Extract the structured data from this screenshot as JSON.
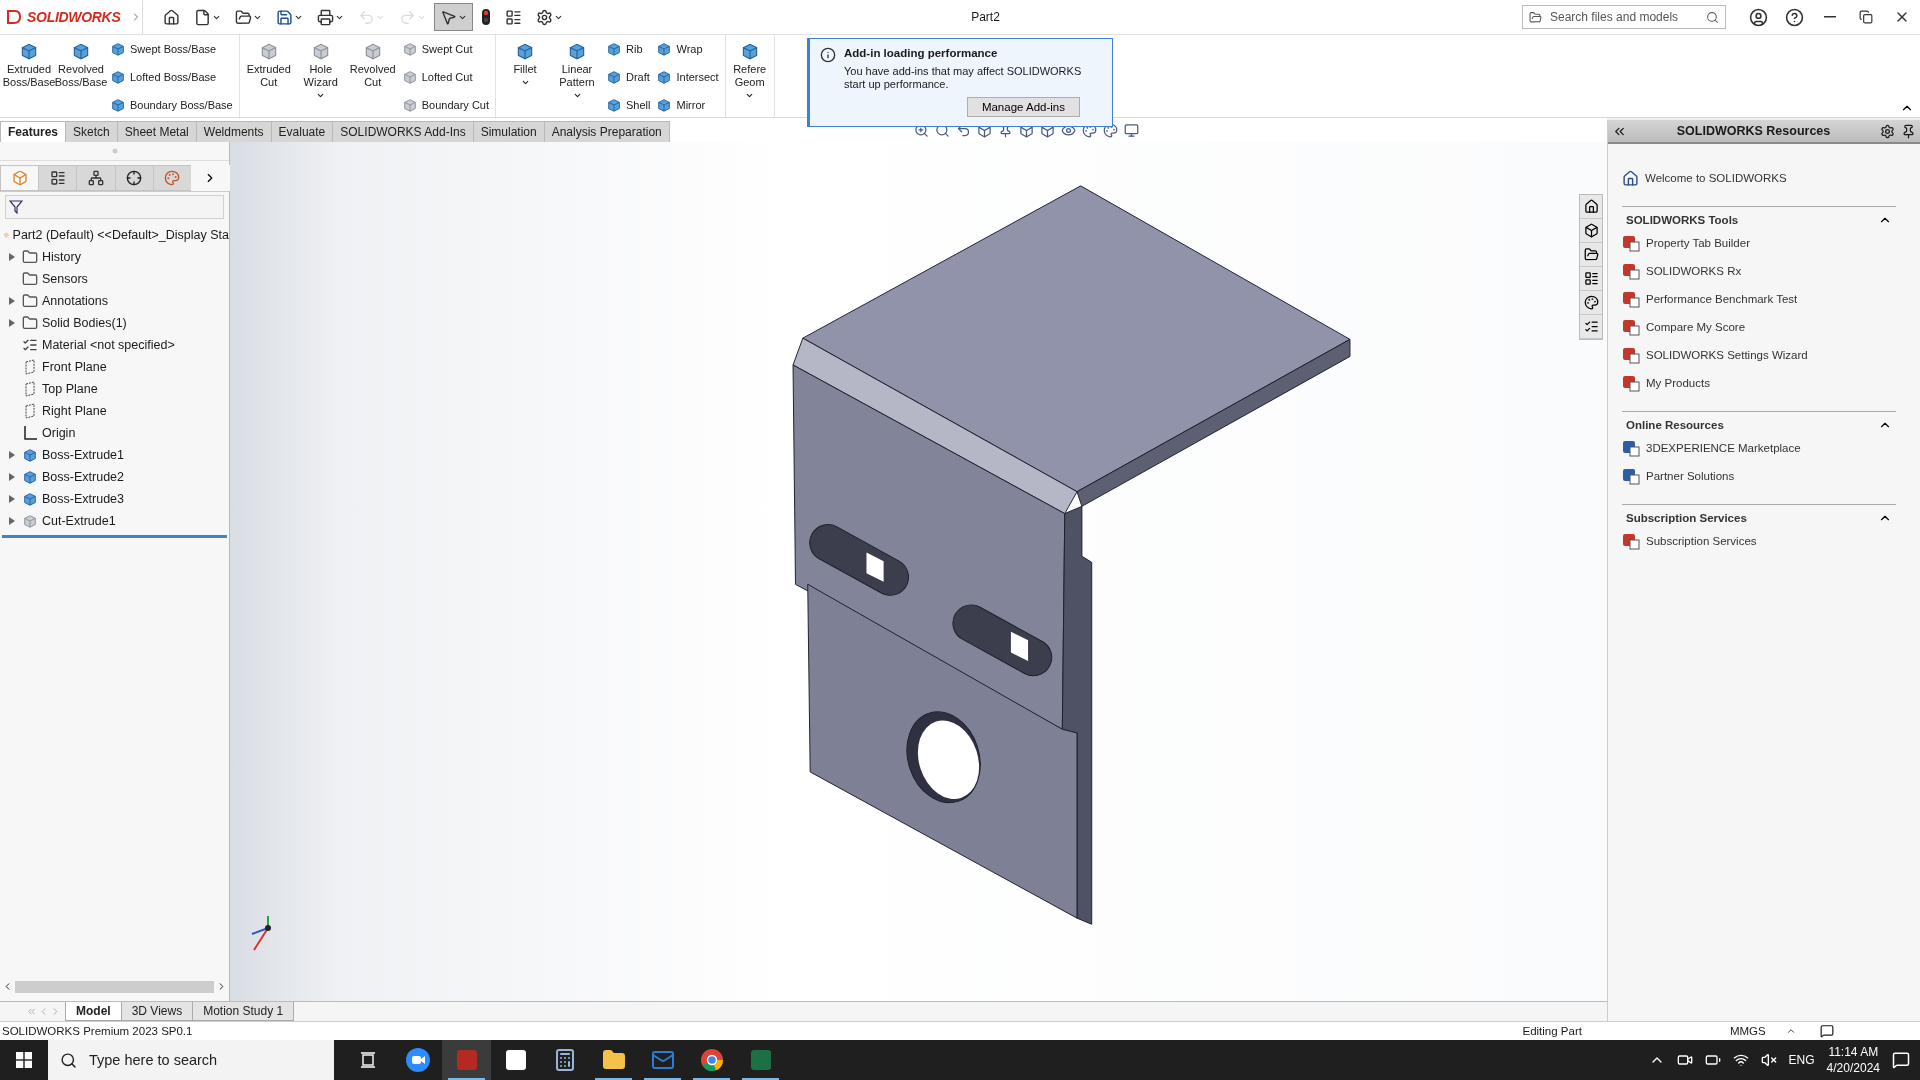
{
  "title_bar": {
    "app_name": "SOLIDWORKS",
    "document_title": "Part2",
    "search_placeholder": "Search files and models"
  },
  "quick_access": [
    {
      "kind": "home",
      "disabled": false,
      "selected": false
    },
    {
      "kind": "new",
      "disabled": false,
      "selected": false
    },
    {
      "kind": "open",
      "disabled": false,
      "selected": false
    },
    {
      "kind": "save",
      "disabled": false,
      "selected": false
    },
    {
      "kind": "print",
      "disabled": false,
      "selected": false
    },
    {
      "kind": "undo",
      "disabled": true,
      "selected": false
    },
    {
      "kind": "redo",
      "disabled": true,
      "selected": false
    },
    {
      "kind": "select",
      "disabled": false,
      "selected": true
    },
    {
      "kind": "rebuild",
      "disabled": false,
      "selected": false
    },
    {
      "kind": "file-properties",
      "disabled": false,
      "selected": false
    },
    {
      "kind": "options",
      "disabled": false,
      "selected": false
    }
  ],
  "ribbon": [
    {
      "items": [
        {
          "kind": "large",
          "label": "Extruded Boss/Base",
          "dropdown": false
        },
        {
          "kind": "large",
          "label": "Revolved Boss/Base",
          "dropdown": false
        },
        {
          "kind": "stack",
          "commands": [
            "Swept Boss/Base",
            "Lofted Boss/Base",
            "Boundary Boss/Base"
          ]
        }
      ]
    },
    {
      "items": [
        {
          "kind": "large",
          "label": "Extruded Cut",
          "dropdown": false
        },
        {
          "kind": "large",
          "label": "Hole Wizard",
          "dropdown": true
        },
        {
          "kind": "large",
          "label": "Revolved Cut",
          "dropdown": false
        },
        {
          "kind": "stack",
          "commands": [
            "Swept Cut",
            "Lofted Cut",
            "Boundary Cut"
          ]
        }
      ]
    },
    {
      "items": [
        {
          "kind": "large",
          "label": "Fillet",
          "dropdown": true
        },
        {
          "kind": "large",
          "label": "Linear Pattern",
          "dropdown": true
        },
        {
          "kind": "stack",
          "commands": [
            "Rib",
            "Draft",
            "Shell"
          ]
        },
        {
          "kind": "stack",
          "commands": [
            "Wrap",
            "Intersect",
            "Mirror"
          ]
        }
      ]
    },
    {
      "items": [
        {
          "kind": "large",
          "label": "Refere Geom",
          "dropdown": true
        }
      ]
    }
  ],
  "command_tabs": [
    {
      "label": "Features",
      "selected": true
    },
    {
      "label": "Sketch",
      "selected": false
    },
    {
      "label": "Sheet Metal",
      "selected": false
    },
    {
      "label": "Weldments",
      "selected": false
    },
    {
      "label": "Evaluate",
      "selected": false
    },
    {
      "label": "SOLIDWORKS Add-Ins",
      "selected": false
    },
    {
      "label": "Simulation",
      "selected": false
    },
    {
      "label": "Analysis Preparation",
      "selected": false
    }
  ],
  "notification": {
    "title": "Add-in loading performance",
    "message": "You have add-ins that may affect SOLIDWORKS start up performance.",
    "button": "Manage Add-ins"
  },
  "panel_tabs": [
    {
      "kind": "feature-manager",
      "selected": true
    },
    {
      "kind": "property-manager",
      "selected": false
    },
    {
      "kind": "configuration-manager",
      "selected": false
    },
    {
      "kind": "dimxpert",
      "selected": false
    },
    {
      "kind": "display-manager",
      "selected": false
    }
  ],
  "feature_tree": {
    "root": "Part2 (Default) <<Default>_Display Sta",
    "items": [
      {
        "label": "History",
        "kind": "folder",
        "expandable": true
      },
      {
        "label": "Sensors",
        "kind": "folder",
        "expandable": false
      },
      {
        "label": "Annotations",
        "kind": "folder",
        "expandable": true
      },
      {
        "label": "Solid Bodies(1)",
        "kind": "folder",
        "expandable": true
      },
      {
        "label": "Material <not specified>",
        "kind": "material",
        "expandable": false
      },
      {
        "label": "Front Plane",
        "kind": "plane",
        "expandable": false
      },
      {
        "label": "Top Plane",
        "kind": "plane",
        "expandable": false
      },
      {
        "label": "Right Plane",
        "kind": "plane",
        "expandable": false
      },
      {
        "label": "Origin",
        "kind": "origin",
        "expandable": false
      },
      {
        "label": "Boss-Extrude1",
        "kind": "boss",
        "expandable": true
      },
      {
        "label": "Boss-Extrude2",
        "kind": "boss",
        "expandable": true
      },
      {
        "label": "Boss-Extrude3",
        "kind": "boss",
        "expandable": true
      },
      {
        "label": "Cut-Extrude1",
        "kind": "cut",
        "expandable": true
      }
    ]
  },
  "bottom_tabs": [
    {
      "label": "Model",
      "selected": true
    },
    {
      "label": "3D Views",
      "selected": false
    },
    {
      "label": "Motion Study 1",
      "selected": false
    }
  ],
  "task_pane": {
    "title": "SOLIDWORKS Resources",
    "welcome": "Welcome to SOLIDWORKS",
    "sections": [
      {
        "title": "SOLIDWORKS Tools",
        "expanded": true,
        "items": [
          "Property Tab Builder",
          "SOLIDWORKS Rx",
          "Performance Benchmark Test",
          "Compare My Score",
          "SOLIDWORKS Settings Wizard",
          "My Products"
        ]
      },
      {
        "title": "Online Resources",
        "expanded": true,
        "items": [
          "3DEXPERIENCE Marketplace",
          "Partner Solutions"
        ]
      },
      {
        "title": "Subscription Services",
        "expanded": true,
        "items": [
          "Subscription Services"
        ]
      }
    ]
  },
  "status_bar": {
    "product": "SOLIDWORKS Premium 2023 SP0.1",
    "mode": "Editing Part",
    "units": "MMGS"
  },
  "taskbar": {
    "search_placeholder": "Type here to search",
    "apps": [
      {
        "kind": "task-view",
        "running": false,
        "active": false
      },
      {
        "kind": "zoom",
        "running": false,
        "active": false
      },
      {
        "kind": "solidworks",
        "running": true,
        "active": true
      },
      {
        "kind": "acrobat",
        "running": false,
        "active": false
      },
      {
        "kind": "calculator",
        "running": false,
        "active": false
      },
      {
        "kind": "explorer",
        "running": true,
        "active": false
      },
      {
        "kind": "outlook",
        "running": true,
        "active": false
      },
      {
        "kind": "chrome",
        "running": true,
        "active": false
      },
      {
        "kind": "excel",
        "running": true,
        "active": false
      }
    ],
    "language": "ENG",
    "time": "11:14 AM",
    "date": "4/20/2024"
  }
}
